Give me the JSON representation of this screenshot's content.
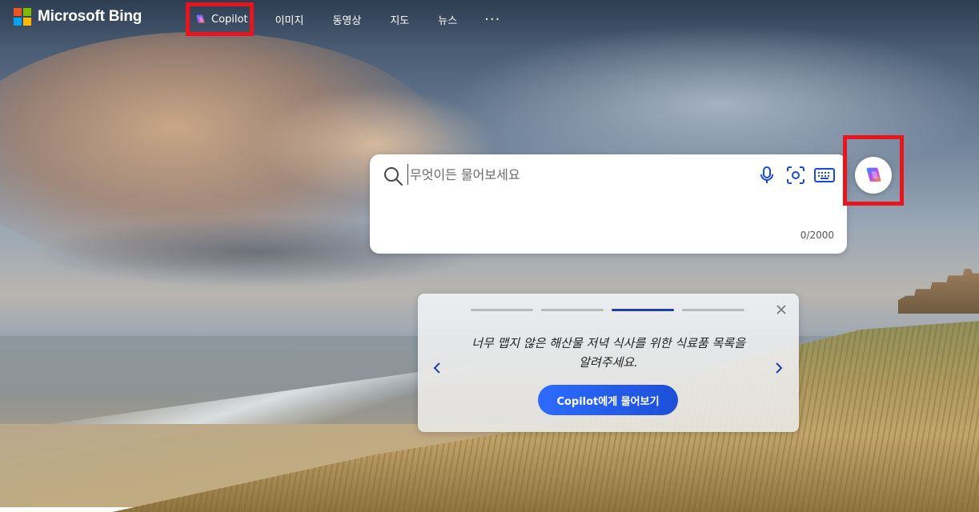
{
  "brand": {
    "name": "Microsoft Bing",
    "logo_colors": [
      "#f25022",
      "#7fba00",
      "#00a4ef",
      "#ffb900"
    ]
  },
  "nav": {
    "items": [
      {
        "label": "Copilot",
        "icon": "copilot-icon"
      },
      {
        "label": "이미지"
      },
      {
        "label": "동영상"
      },
      {
        "label": "지도"
      },
      {
        "label": "뉴스"
      },
      {
        "label": "···"
      }
    ]
  },
  "search": {
    "placeholder": "무엇이든 물어보세요",
    "value": "",
    "counter": "0/2000",
    "tools": [
      "microphone-icon",
      "visual-search-icon",
      "keyboard-icon"
    ]
  },
  "copilot_button": {
    "icon": "copilot-icon"
  },
  "suggestion_card": {
    "pages": 4,
    "active_page": 3,
    "text": "너무 맵지 않은 해산물 저녁 식사를 위한 식료품 목록을 알려주세요.",
    "cta_label": "Copilot에게 물어보기"
  },
  "colors": {
    "highlight": "#e8151f",
    "accent": "#1f3fa8",
    "cta": "#2d6bff"
  }
}
